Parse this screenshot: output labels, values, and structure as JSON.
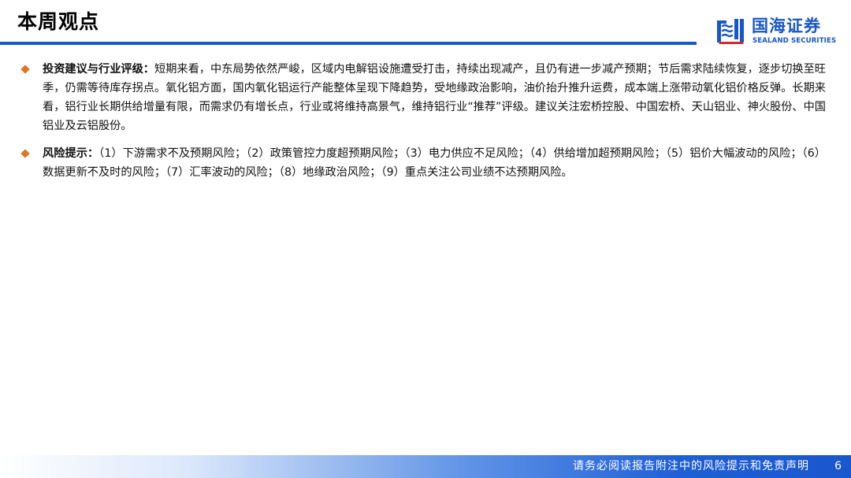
{
  "header": {
    "title": "本周观点",
    "logo_cn": "国海证券",
    "logo_en": "SEALAND SECURITIES"
  },
  "content": {
    "bullets": [
      {
        "lead": "投资建议与行业评级：",
        "text": "短期来看，中东局势依然严峻，区域内电解铝设施遭受打击，持续出现减产，且仍有进一步减产预期；节后需求陆续恢复，逐步切换至旺季，仍需等待库存拐点。氧化铝方面，国内氧化铝运行产能整体呈现下降趋势，受地缘政治影响，油价抬升推升运费，成本端上涨带动氧化铝价格反弹。长期来看，铝行业长期供给增量有限，而需求仍有增长点，行业或将维持高景气，维持铝行业“推荐”评级。建议关注宏桥控股、中国宏桥、天山铝业、神火股份、中国铝业及云铝股份。"
      },
      {
        "lead": "风险提示：",
        "text": "（1）下游需求不及预期风险；（2）政策管控力度超预期风险；（3）电力供应不足风险；（4）供给增加超预期风险；（5）铝价大幅波动的风险；（6）数据更新不及时的风险；（7）汇率波动的风险；（8）地缘政治风险；（9）重点关注公司业绩不达预期风险。"
      }
    ]
  },
  "footer": {
    "disclaimer": "请务必阅读报告附注中的风险提示和免责声明",
    "page_number": "6"
  },
  "colors": {
    "brand_blue": "#1957c6",
    "bullet_orange": "#e8711f",
    "title_rule": "#1a57c8"
  }
}
